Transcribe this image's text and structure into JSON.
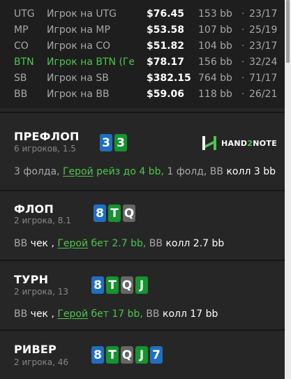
{
  "players": [
    {
      "pos": "UTG",
      "name": "Игрок на UTG",
      "amount": "$76.45",
      "bb": "153 bb",
      "dot": "·",
      "hands": "23/17",
      "hero": false
    },
    {
      "pos": "MP",
      "name": "Игрок на MP",
      "amount": "$53.58",
      "bb": "107 bb",
      "dot": "·",
      "hands": "25/19",
      "hero": false
    },
    {
      "pos": "CO",
      "name": "Игрок на CO",
      "amount": "$51.82",
      "bb": "104 bb",
      "dot": "·",
      "hands": "23/17",
      "hero": false
    },
    {
      "pos": "BTN",
      "name": "Игрок на BTN (Ге",
      "amount": "$78.17",
      "bb": "156 bb",
      "dot": "·",
      "hands": "32/24",
      "hero": true
    },
    {
      "pos": "SB",
      "name": "Игрок на SB",
      "amount": "$382.15",
      "bb": "764 bb",
      "dot": "·",
      "hands": "71/17",
      "hero": false
    },
    {
      "pos": "BB",
      "name": "Игрок на BB",
      "amount": "$59.06",
      "bb": "118 bb",
      "dot": "·",
      "hands": "26/21",
      "hero": false
    }
  ],
  "logo": {
    "text_prefix": "HAND",
    "text_num": "2",
    "text_suffix": "NOTE",
    "color": "#4cc64c"
  },
  "preflop": {
    "title": "ПРЕФЛОП",
    "subtitle": "6 игроков, 1.5",
    "cards": [
      {
        "rank": "3",
        "suit": "diamonds"
      },
      {
        "rank": "3",
        "suit": "clubs"
      }
    ],
    "action": {
      "a": "3 фолда, ",
      "b": "Герой",
      "c": " рейз до 4 bb,",
      "d": " 1 фолд, BB ",
      "e": "колл 3 bb"
    }
  },
  "flop": {
    "title": "ФЛОП",
    "subtitle": "2 игрока, 8.1",
    "cards": [
      {
        "rank": "8",
        "suit": "diamonds"
      },
      {
        "rank": "T",
        "suit": "clubs"
      },
      {
        "rank": "Q",
        "suit": "hearts"
      }
    ],
    "action": {
      "a": "BB ",
      "b": "чек",
      "c": " , ",
      "d": "Герой",
      "e": " бет 2.7 bb,",
      "f": " BB ",
      "g": "колл 2.7 bb"
    }
  },
  "turn": {
    "title": "ТУРН",
    "subtitle": "2 игрока, 13",
    "cards": [
      {
        "rank": "8",
        "suit": "diamonds"
      },
      {
        "rank": "T",
        "suit": "clubs"
      },
      {
        "rank": "Q",
        "suit": "hearts"
      },
      {
        "rank": "J",
        "suit": "clubs"
      }
    ],
    "action": {
      "a": "BB ",
      "b": "чек",
      "c": " , ",
      "d": "Герой",
      "e": " бет 17 bb,",
      "f": " BB ",
      "g": "колл 17 bb"
    }
  },
  "river": {
    "title": "РИВЕР",
    "subtitle": "2 игрока, 46",
    "cards": [
      {
        "rank": "8",
        "suit": "diamonds"
      },
      {
        "rank": "T",
        "suit": "clubs"
      },
      {
        "rank": "Q",
        "suit": "hearts"
      },
      {
        "rank": "J",
        "suit": "clubs"
      },
      {
        "rank": "7",
        "suit": "diamonds"
      }
    ]
  },
  "colors": {
    "diamonds": "#1f6fc0",
    "clubs": "#15932f",
    "hearts": "#666666",
    "hero": "#4cc64c"
  }
}
